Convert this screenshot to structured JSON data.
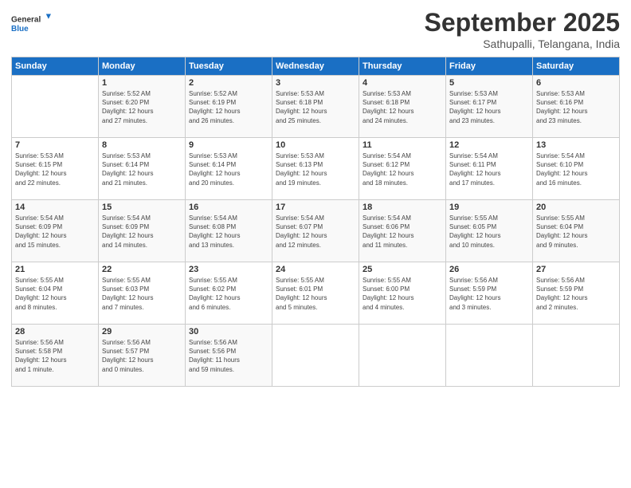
{
  "header": {
    "logo_general": "General",
    "logo_blue": "Blue",
    "month_title": "September 2025",
    "location": "Sathupalli, Telangana, India"
  },
  "weekdays": [
    "Sunday",
    "Monday",
    "Tuesday",
    "Wednesday",
    "Thursday",
    "Friday",
    "Saturday"
  ],
  "weeks": [
    [
      {
        "day": "",
        "info": ""
      },
      {
        "day": "1",
        "info": "Sunrise: 5:52 AM\nSunset: 6:20 PM\nDaylight: 12 hours\nand 27 minutes."
      },
      {
        "day": "2",
        "info": "Sunrise: 5:52 AM\nSunset: 6:19 PM\nDaylight: 12 hours\nand 26 minutes."
      },
      {
        "day": "3",
        "info": "Sunrise: 5:53 AM\nSunset: 6:18 PM\nDaylight: 12 hours\nand 25 minutes."
      },
      {
        "day": "4",
        "info": "Sunrise: 5:53 AM\nSunset: 6:18 PM\nDaylight: 12 hours\nand 24 minutes."
      },
      {
        "day": "5",
        "info": "Sunrise: 5:53 AM\nSunset: 6:17 PM\nDaylight: 12 hours\nand 23 minutes."
      },
      {
        "day": "6",
        "info": "Sunrise: 5:53 AM\nSunset: 6:16 PM\nDaylight: 12 hours\nand 23 minutes."
      }
    ],
    [
      {
        "day": "7",
        "info": "Sunrise: 5:53 AM\nSunset: 6:15 PM\nDaylight: 12 hours\nand 22 minutes."
      },
      {
        "day": "8",
        "info": "Sunrise: 5:53 AM\nSunset: 6:14 PM\nDaylight: 12 hours\nand 21 minutes."
      },
      {
        "day": "9",
        "info": "Sunrise: 5:53 AM\nSunset: 6:14 PM\nDaylight: 12 hours\nand 20 minutes."
      },
      {
        "day": "10",
        "info": "Sunrise: 5:53 AM\nSunset: 6:13 PM\nDaylight: 12 hours\nand 19 minutes."
      },
      {
        "day": "11",
        "info": "Sunrise: 5:54 AM\nSunset: 6:12 PM\nDaylight: 12 hours\nand 18 minutes."
      },
      {
        "day": "12",
        "info": "Sunrise: 5:54 AM\nSunset: 6:11 PM\nDaylight: 12 hours\nand 17 minutes."
      },
      {
        "day": "13",
        "info": "Sunrise: 5:54 AM\nSunset: 6:10 PM\nDaylight: 12 hours\nand 16 minutes."
      }
    ],
    [
      {
        "day": "14",
        "info": "Sunrise: 5:54 AM\nSunset: 6:09 PM\nDaylight: 12 hours\nand 15 minutes."
      },
      {
        "day": "15",
        "info": "Sunrise: 5:54 AM\nSunset: 6:09 PM\nDaylight: 12 hours\nand 14 minutes."
      },
      {
        "day": "16",
        "info": "Sunrise: 5:54 AM\nSunset: 6:08 PM\nDaylight: 12 hours\nand 13 minutes."
      },
      {
        "day": "17",
        "info": "Sunrise: 5:54 AM\nSunset: 6:07 PM\nDaylight: 12 hours\nand 12 minutes."
      },
      {
        "day": "18",
        "info": "Sunrise: 5:54 AM\nSunset: 6:06 PM\nDaylight: 12 hours\nand 11 minutes."
      },
      {
        "day": "19",
        "info": "Sunrise: 5:55 AM\nSunset: 6:05 PM\nDaylight: 12 hours\nand 10 minutes."
      },
      {
        "day": "20",
        "info": "Sunrise: 5:55 AM\nSunset: 6:04 PM\nDaylight: 12 hours\nand 9 minutes."
      }
    ],
    [
      {
        "day": "21",
        "info": "Sunrise: 5:55 AM\nSunset: 6:04 PM\nDaylight: 12 hours\nand 8 minutes."
      },
      {
        "day": "22",
        "info": "Sunrise: 5:55 AM\nSunset: 6:03 PM\nDaylight: 12 hours\nand 7 minutes."
      },
      {
        "day": "23",
        "info": "Sunrise: 5:55 AM\nSunset: 6:02 PM\nDaylight: 12 hours\nand 6 minutes."
      },
      {
        "day": "24",
        "info": "Sunrise: 5:55 AM\nSunset: 6:01 PM\nDaylight: 12 hours\nand 5 minutes."
      },
      {
        "day": "25",
        "info": "Sunrise: 5:55 AM\nSunset: 6:00 PM\nDaylight: 12 hours\nand 4 minutes."
      },
      {
        "day": "26",
        "info": "Sunrise: 5:56 AM\nSunset: 5:59 PM\nDaylight: 12 hours\nand 3 minutes."
      },
      {
        "day": "27",
        "info": "Sunrise: 5:56 AM\nSunset: 5:59 PM\nDaylight: 12 hours\nand 2 minutes."
      }
    ],
    [
      {
        "day": "28",
        "info": "Sunrise: 5:56 AM\nSunset: 5:58 PM\nDaylight: 12 hours\nand 1 minute."
      },
      {
        "day": "29",
        "info": "Sunrise: 5:56 AM\nSunset: 5:57 PM\nDaylight: 12 hours\nand 0 minutes."
      },
      {
        "day": "30",
        "info": "Sunrise: 5:56 AM\nSunset: 5:56 PM\nDaylight: 11 hours\nand 59 minutes."
      },
      {
        "day": "",
        "info": ""
      },
      {
        "day": "",
        "info": ""
      },
      {
        "day": "",
        "info": ""
      },
      {
        "day": "",
        "info": ""
      }
    ]
  ]
}
